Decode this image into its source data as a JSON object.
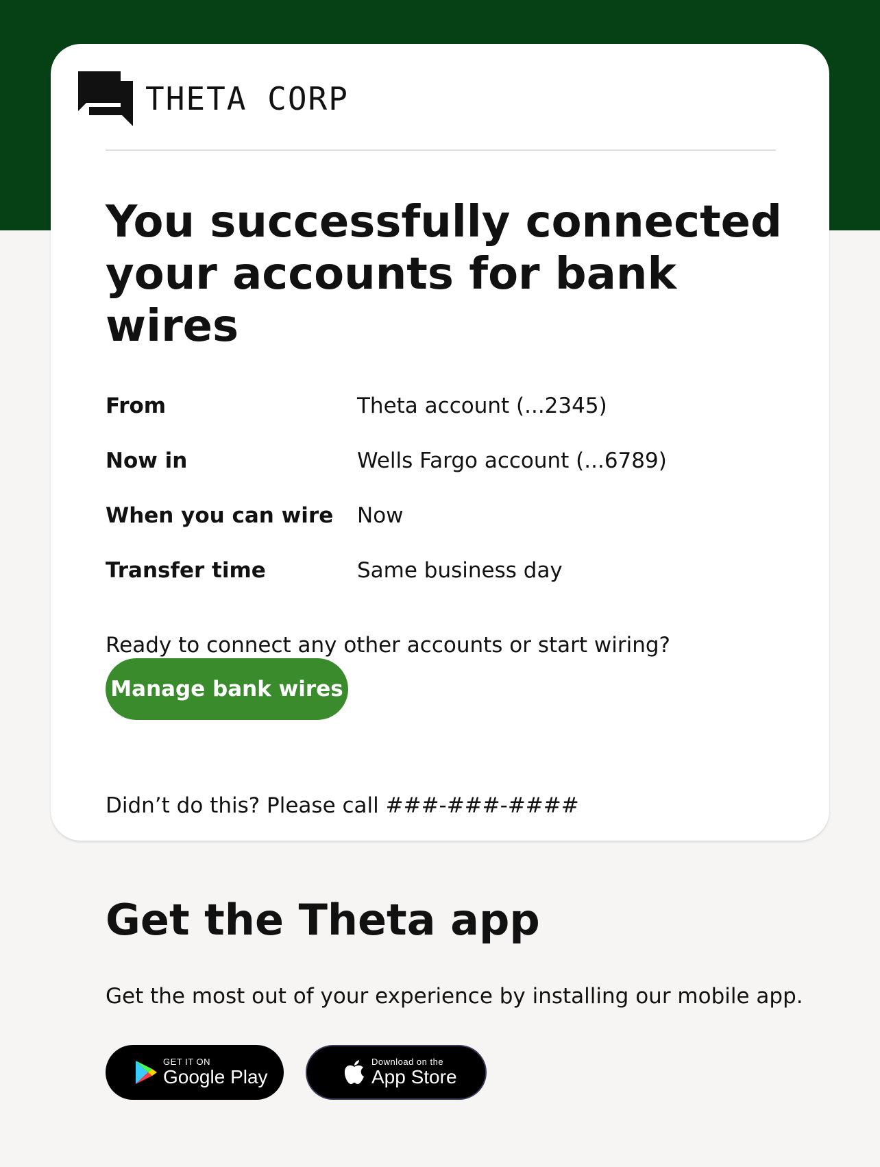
{
  "brand": {
    "name": "THETA CORP",
    "icon": "chat-bubbles-icon"
  },
  "confirmation": {
    "headline_line1": "You successfully connected",
    "headline_line2": "your accounts for bank wires",
    "details": [
      {
        "label": "From",
        "value": "Theta account (...2345)"
      },
      {
        "label": "Now in",
        "value": "Wells Fargo account (...6789)"
      },
      {
        "label": "When you can wire",
        "value": "Now"
      },
      {
        "label": "Transfer time",
        "value": "Same business day"
      }
    ],
    "prompt": "Ready to connect any other accounts or start wiring?",
    "button_label": "Manage bank wires",
    "call_notice": "Didn’t do this? Please call ###-###-####"
  },
  "app_promo": {
    "title": "Get the Theta app",
    "description": "Get the most out of your experience by installing our mobile app.",
    "google_play": {
      "small": "GET IT ON",
      "big": "Google Play",
      "icon": "google-play-icon"
    },
    "app_store": {
      "small": "Download on the",
      "big": "App Store",
      "icon": "apple-icon"
    }
  },
  "colors": {
    "header_band": "#064116",
    "button": "#398b2c",
    "background": "#f6f5f3",
    "card": "#ffffff"
  }
}
